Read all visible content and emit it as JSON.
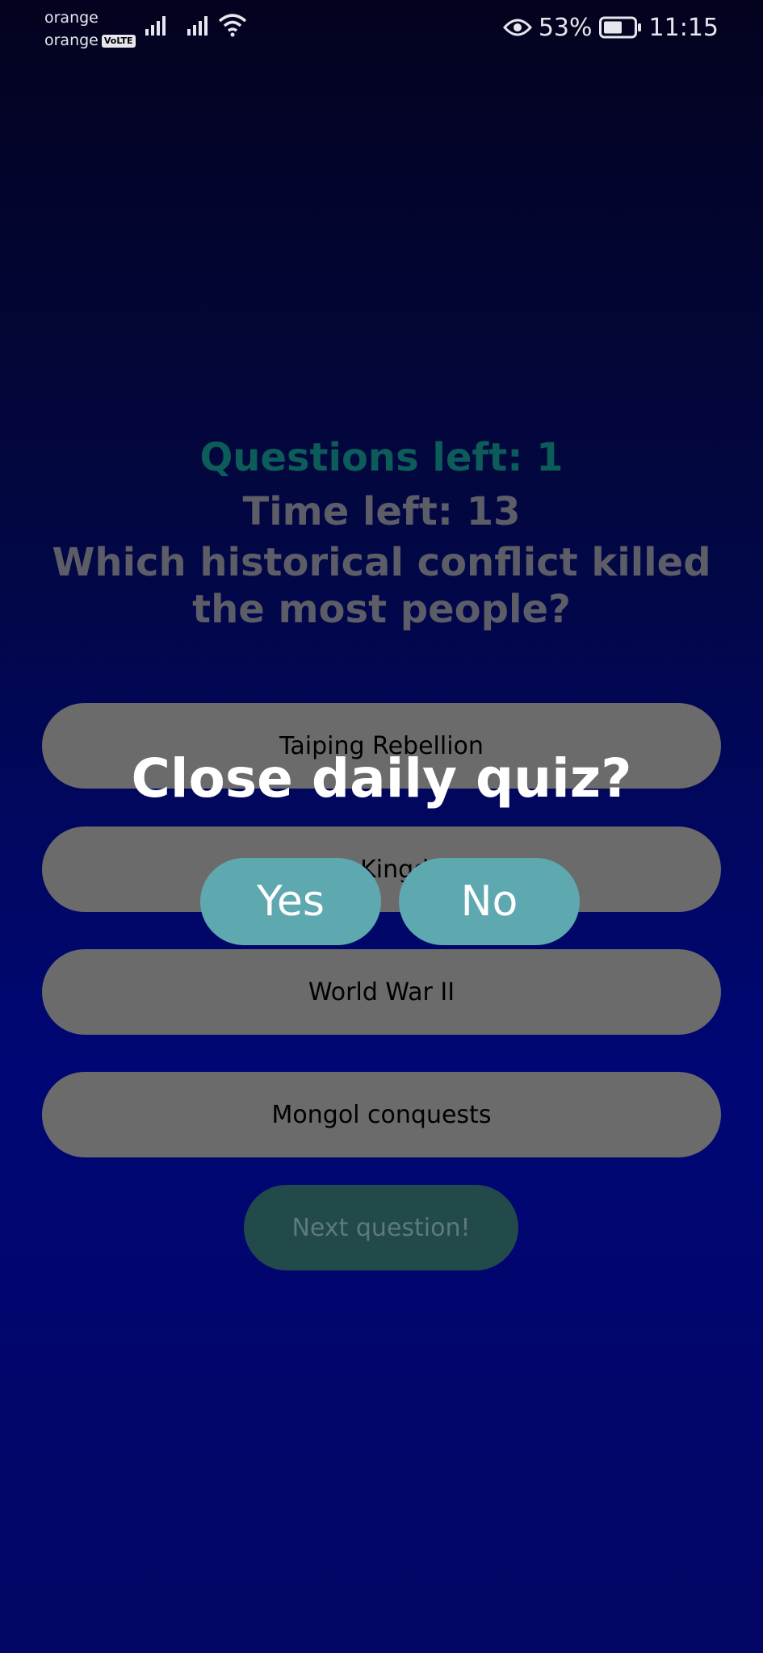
{
  "status_bar": {
    "carrier1": "orange",
    "carrier2": "orange",
    "volte_badge": "VoLTE",
    "battery_percent": "53%",
    "time": "11:15",
    "icons": [
      "signal-icon",
      "signal-icon",
      "wifi-icon",
      "eye-icon",
      "battery-icon"
    ]
  },
  "quiz": {
    "questions_left": "Questions left: 1",
    "time_left": "Time left: 13",
    "question": "Which historical conflict killed the most people?",
    "answers": [
      "Taiping Rebellion",
      "Three Kingdoms",
      "World War II",
      "Mongol conquests"
    ],
    "next_button": "Next question!"
  },
  "dialog": {
    "title": "Close daily quiz?",
    "yes": "Yes",
    "no": "No"
  },
  "colors": {
    "accent_teal": "#5ea8b0",
    "answer_gray": "#6b6b6b",
    "questions_left_green": "#0c5c5a",
    "background_blue": "#000775"
  }
}
